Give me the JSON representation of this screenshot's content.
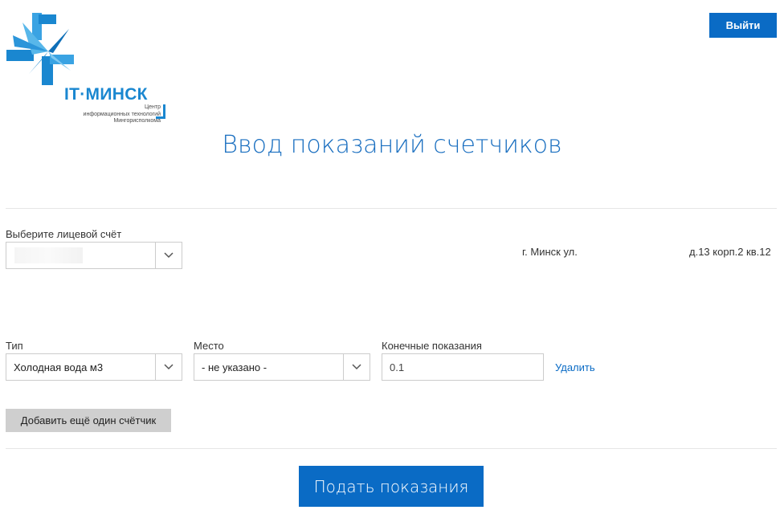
{
  "logo": {
    "name": "IT·МИНСК",
    "sub_line1": "Центр",
    "sub_line2": "информационных технологий",
    "sub_line3": "Мингорисполкома"
  },
  "header": {
    "logout_label": "Выйти"
  },
  "page": {
    "title": "Ввод показаний счетчиков"
  },
  "account": {
    "label": "Выберите лицевой счёт",
    "selected_value": "",
    "address_part1": "г. Минск ул.",
    "address_part2": "д.13 корп.2 кв.12"
  },
  "meter": {
    "type_label": "Тип",
    "type_value": "Холодная вода м3",
    "place_label": "Место",
    "place_value": "- не указано -",
    "reading_label": "Конечные показания",
    "reading_value": "0.1",
    "delete_label": "Удалить"
  },
  "actions": {
    "add_meter_label": "Добавить ещё один счётчик",
    "submit_label": "Подать показания"
  },
  "colors": {
    "accent": "#0a6bc5",
    "title": "#1a6fc0",
    "logo": "#1a87d0"
  },
  "icons": {
    "dropdown": "chevron-down-icon"
  }
}
